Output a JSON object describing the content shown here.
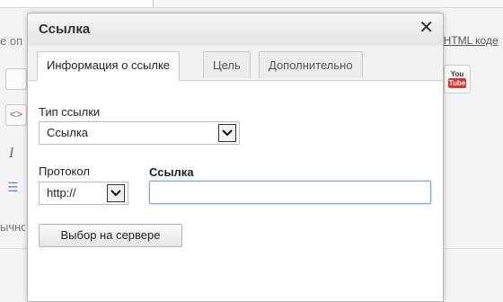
{
  "background": {
    "left_fragment_1": "е оп",
    "left_fragment_2": "ычно",
    "right_link": "ь HTML коде",
    "youtube_icon": "youtube-icon",
    "yt_top": "You",
    "yt_bottom": "Tube"
  },
  "dialog": {
    "title": "Ссылка",
    "close_icon": "close-icon",
    "tabs": [
      {
        "label": "Информация о ссылке",
        "active": true
      },
      {
        "label": "Цель",
        "active": false
      },
      {
        "label": "Дополнительно",
        "active": false
      }
    ],
    "link_type": {
      "label": "Тип ссылки",
      "value": "Ссылка"
    },
    "protocol": {
      "label": "Протокол",
      "value": "http://"
    },
    "url": {
      "label": "Ссылка",
      "value": ""
    },
    "browse_button": "Выбор на сервере"
  }
}
